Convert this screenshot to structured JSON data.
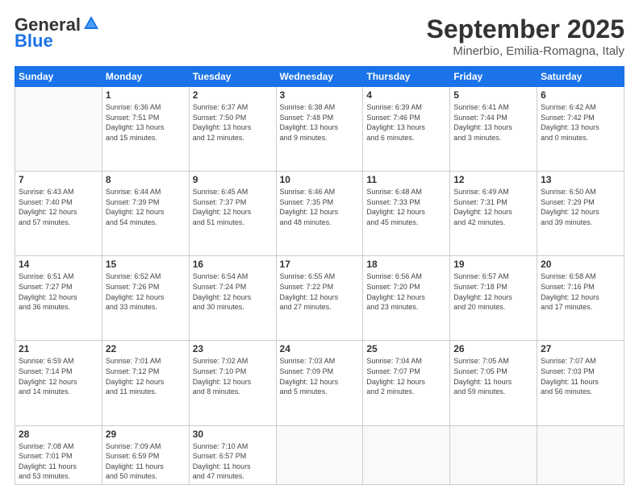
{
  "header": {
    "logo_general": "General",
    "logo_blue": "Blue",
    "month": "September 2025",
    "location": "Minerbio, Emilia-Romagna, Italy"
  },
  "weekdays": [
    "Sunday",
    "Monday",
    "Tuesday",
    "Wednesday",
    "Thursday",
    "Friday",
    "Saturday"
  ],
  "weeks": [
    [
      {
        "day": "",
        "info": ""
      },
      {
        "day": "1",
        "info": "Sunrise: 6:36 AM\nSunset: 7:51 PM\nDaylight: 13 hours\nand 15 minutes."
      },
      {
        "day": "2",
        "info": "Sunrise: 6:37 AM\nSunset: 7:50 PM\nDaylight: 13 hours\nand 12 minutes."
      },
      {
        "day": "3",
        "info": "Sunrise: 6:38 AM\nSunset: 7:48 PM\nDaylight: 13 hours\nand 9 minutes."
      },
      {
        "day": "4",
        "info": "Sunrise: 6:39 AM\nSunset: 7:46 PM\nDaylight: 13 hours\nand 6 minutes."
      },
      {
        "day": "5",
        "info": "Sunrise: 6:41 AM\nSunset: 7:44 PM\nDaylight: 13 hours\nand 3 minutes."
      },
      {
        "day": "6",
        "info": "Sunrise: 6:42 AM\nSunset: 7:42 PM\nDaylight: 13 hours\nand 0 minutes."
      }
    ],
    [
      {
        "day": "7",
        "info": "Sunrise: 6:43 AM\nSunset: 7:40 PM\nDaylight: 12 hours\nand 57 minutes."
      },
      {
        "day": "8",
        "info": "Sunrise: 6:44 AM\nSunset: 7:39 PM\nDaylight: 12 hours\nand 54 minutes."
      },
      {
        "day": "9",
        "info": "Sunrise: 6:45 AM\nSunset: 7:37 PM\nDaylight: 12 hours\nand 51 minutes."
      },
      {
        "day": "10",
        "info": "Sunrise: 6:46 AM\nSunset: 7:35 PM\nDaylight: 12 hours\nand 48 minutes."
      },
      {
        "day": "11",
        "info": "Sunrise: 6:48 AM\nSunset: 7:33 PM\nDaylight: 12 hours\nand 45 minutes."
      },
      {
        "day": "12",
        "info": "Sunrise: 6:49 AM\nSunset: 7:31 PM\nDaylight: 12 hours\nand 42 minutes."
      },
      {
        "day": "13",
        "info": "Sunrise: 6:50 AM\nSunset: 7:29 PM\nDaylight: 12 hours\nand 39 minutes."
      }
    ],
    [
      {
        "day": "14",
        "info": "Sunrise: 6:51 AM\nSunset: 7:27 PM\nDaylight: 12 hours\nand 36 minutes."
      },
      {
        "day": "15",
        "info": "Sunrise: 6:52 AM\nSunset: 7:26 PM\nDaylight: 12 hours\nand 33 minutes."
      },
      {
        "day": "16",
        "info": "Sunrise: 6:54 AM\nSunset: 7:24 PM\nDaylight: 12 hours\nand 30 minutes."
      },
      {
        "day": "17",
        "info": "Sunrise: 6:55 AM\nSunset: 7:22 PM\nDaylight: 12 hours\nand 27 minutes."
      },
      {
        "day": "18",
        "info": "Sunrise: 6:56 AM\nSunset: 7:20 PM\nDaylight: 12 hours\nand 23 minutes."
      },
      {
        "day": "19",
        "info": "Sunrise: 6:57 AM\nSunset: 7:18 PM\nDaylight: 12 hours\nand 20 minutes."
      },
      {
        "day": "20",
        "info": "Sunrise: 6:58 AM\nSunset: 7:16 PM\nDaylight: 12 hours\nand 17 minutes."
      }
    ],
    [
      {
        "day": "21",
        "info": "Sunrise: 6:59 AM\nSunset: 7:14 PM\nDaylight: 12 hours\nand 14 minutes."
      },
      {
        "day": "22",
        "info": "Sunrise: 7:01 AM\nSunset: 7:12 PM\nDaylight: 12 hours\nand 11 minutes."
      },
      {
        "day": "23",
        "info": "Sunrise: 7:02 AM\nSunset: 7:10 PM\nDaylight: 12 hours\nand 8 minutes."
      },
      {
        "day": "24",
        "info": "Sunrise: 7:03 AM\nSunset: 7:09 PM\nDaylight: 12 hours\nand 5 minutes."
      },
      {
        "day": "25",
        "info": "Sunrise: 7:04 AM\nSunset: 7:07 PM\nDaylight: 12 hours\nand 2 minutes."
      },
      {
        "day": "26",
        "info": "Sunrise: 7:05 AM\nSunset: 7:05 PM\nDaylight: 11 hours\nand 59 minutes."
      },
      {
        "day": "27",
        "info": "Sunrise: 7:07 AM\nSunset: 7:03 PM\nDaylight: 11 hours\nand 56 minutes."
      }
    ],
    [
      {
        "day": "28",
        "info": "Sunrise: 7:08 AM\nSunset: 7:01 PM\nDaylight: 11 hours\nand 53 minutes."
      },
      {
        "day": "29",
        "info": "Sunrise: 7:09 AM\nSunset: 6:59 PM\nDaylight: 11 hours\nand 50 minutes."
      },
      {
        "day": "30",
        "info": "Sunrise: 7:10 AM\nSunset: 6:57 PM\nDaylight: 11 hours\nand 47 minutes."
      },
      {
        "day": "",
        "info": ""
      },
      {
        "day": "",
        "info": ""
      },
      {
        "day": "",
        "info": ""
      },
      {
        "day": "",
        "info": ""
      }
    ]
  ]
}
